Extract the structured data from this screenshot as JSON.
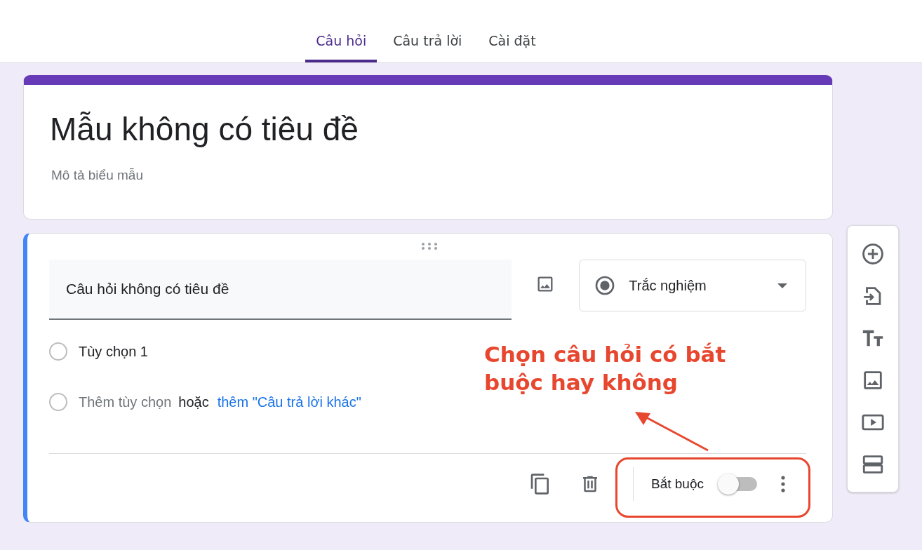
{
  "tabs": [
    {
      "label": "Câu hỏi",
      "selected": true
    },
    {
      "label": "Câu trả lời",
      "selected": false
    },
    {
      "label": "Cài đặt",
      "selected": false
    }
  ],
  "form": {
    "title": "Mẫu không có tiêu đề",
    "description_placeholder": "Mô tả biểu mẫu"
  },
  "question": {
    "title": "Câu hỏi không có tiêu đề",
    "type": "Trắc nghiệm",
    "options": [
      {
        "label": "Tùy chọn 1",
        "selected": false
      }
    ],
    "add_option": "Thêm tùy chọn",
    "add_option_selected": false,
    "or": "hoặc",
    "add_other": "thêm \"Câu trả lời khác\"",
    "required_label": "Bắt buộc",
    "required": false
  },
  "annotation": {
    "text": "Chọn câu hỏi có bắt buộc hay không",
    "color": "#e8472f"
  }
}
